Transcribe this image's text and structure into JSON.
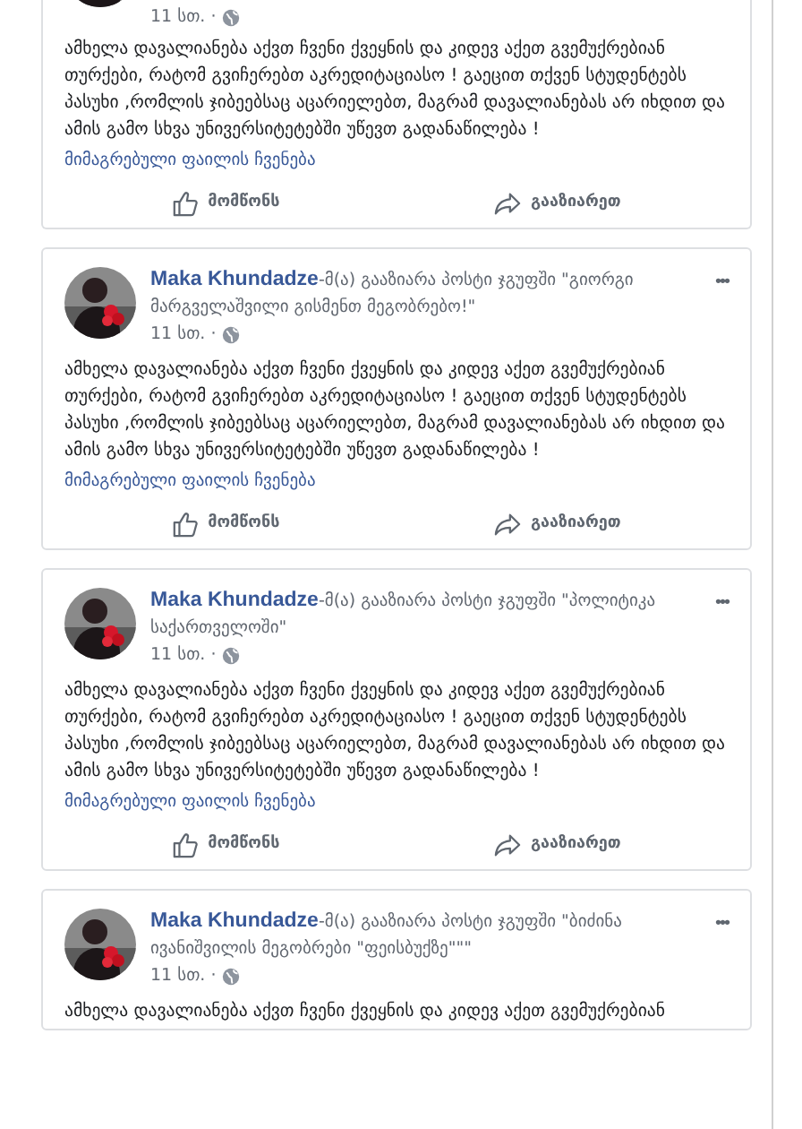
{
  "posts": [
    {
      "time": "11 სთ. ·",
      "body": "ამხელა დავალიანება აქვთ ჩვენი ქვეყნის და კიდევ აქეთ გვემუქრებიან თურქები, რატომ გვიჩერებთ აკრედიტაციასო ! გაეცით თქვენ სტუდენტებს პასუხი ,რომლის ჯიბეებსაც აცარიელებთ, მაგრამ დავალიანებას არ იხდით და ამის გამო სხვა უნივერსიტეტებში უწევთ გადანაწილება !",
      "attachment_link": "მიმაგრებული ფაილის ჩვენება",
      "actions": [
        {
          "kind": "like",
          "label": "მომწონს"
        },
        {
          "kind": "share",
          "label": "გააზიარეთ"
        }
      ]
    },
    {
      "author": "Maka Khundadze",
      "action": "-მ(ა) გააზიარა პოსტი ჯგუფში \"გიორგი მარგველაშვილი გისმენთ მეგობრებო!\"",
      "more": "•••",
      "time": "11 სთ. ·",
      "body": "ამხელა დავალიანება აქვთ ჩვენი ქვეყნის და კიდევ აქეთ გვემუქრებიან თურქები, რატომ გვიჩერებთ აკრედიტაციასო ! გაეცით თქვენ სტუდენტებს პასუხი ,რომლის ჯიბეებსაც აცარიელებთ, მაგრამ დავალიანებას არ იხდით და ამის გამო სხვა უნივერსიტეტებში უწევთ გადანაწილება !",
      "attachment_link": "მიმაგრებული ფაილის ჩვენება",
      "actions": [
        {
          "kind": "like",
          "label": "მომწონს"
        },
        {
          "kind": "share",
          "label": "გააზიარეთ"
        }
      ]
    },
    {
      "author": "Maka Khundadze",
      "action": "-მ(ა) გააზიარა პოსტი ჯგუფში \"პოლიტიკა საქართველოში\"",
      "more": "•••",
      "time": "11 სთ. ·",
      "body": "ამხელა დავალიანება აქვთ ჩვენი ქვეყნის და კიდევ აქეთ გვემუქრებიან თურქები, რატომ გვიჩერებთ აკრედიტაციასო ! გაეცით თქვენ სტუდენტებს პასუხი ,რომლის ჯიბეებსაც აცარიელებთ, მაგრამ დავალიანებას არ იხდით და ამის გამო სხვა უნივერსიტეტებში უწევთ გადანაწილება !",
      "attachment_link": "მიმაგრებული ფაილის ჩვენება",
      "actions": [
        {
          "kind": "like",
          "label": "მომწონს"
        },
        {
          "kind": "share",
          "label": "გააზიარეთ"
        }
      ]
    },
    {
      "author": "Maka Khundadze",
      "action": "-მ(ა) გააზიარა პოსტი ჯგუფში \"ბიძინა ივანიშვილის მეგობრები \"ფეისბუქზე\"\"\"",
      "more": "•••",
      "time": "11 სთ. ·",
      "body": "ამხელა დავალიანება აქვთ ჩვენი ქვეყნის და კიდევ აქეთ გვემუქრებიან"
    }
  ]
}
